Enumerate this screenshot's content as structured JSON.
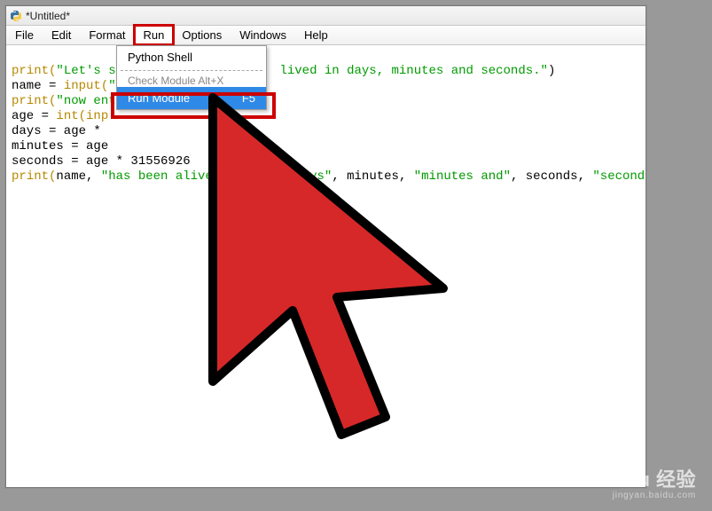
{
  "window": {
    "title": "*Untitled*"
  },
  "menus": {
    "file": "File",
    "edit": "Edit",
    "format": "Format",
    "run": "Run",
    "options": "Options",
    "windows": "Windows",
    "help": "Help"
  },
  "dropdown": {
    "python_shell": "Python Shell",
    "check_module": "Check Module   Alt+X",
    "run_module_label": "Run Module",
    "run_module_accel": "F5"
  },
  "code": {
    "l1_a": "print(",
    "l1_b": "\"Let's s",
    "l1_c": " lived in days, minutes and seconds.\"",
    "l1_d": ")",
    "l2_a": "name = ",
    "l2_b": "input(",
    "l2_c": "\"",
    "l3_a": "print(",
    "l3_b": "\"now ent",
    "l4_a": "age = ",
    "l4_b": "int(inp",
    "l5": "days = age * ",
    "l6": "minutes = age",
    "l7": "seconds = age * 31556926",
    "l8_a": "print(",
    "l8_b": "name, ",
    "l8_c": "\"has been alive for",
    "l8_d": "     ,",
    "l8_e": "\"days\"",
    "l8_f": ", minutes, ",
    "l8_g": "\"minutes and\"",
    "l8_h": ", seconds, ",
    "l8_i": "\"seconds!  Wow!\""
  },
  "watermark": {
    "main": "Baidu 经验",
    "sub": "jingyan.baidu.com"
  }
}
